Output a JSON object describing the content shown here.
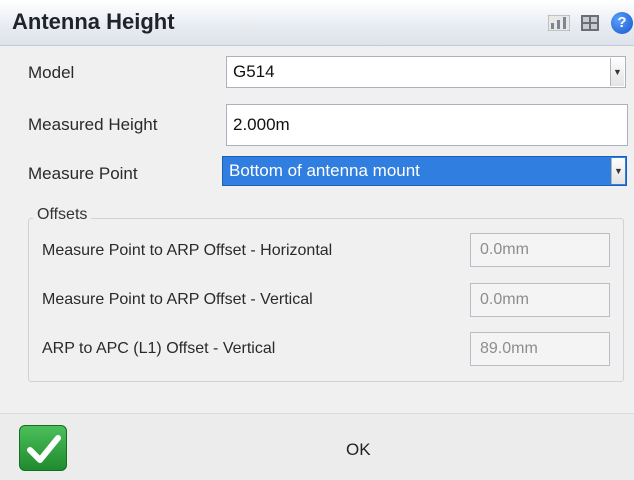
{
  "window": {
    "title": "Antenna Height",
    "icons": [
      "chart-icon",
      "grid-icon",
      "help-icon"
    ]
  },
  "form": {
    "model": {
      "label": "Model",
      "value": "G514"
    },
    "measured_height": {
      "label": "Measured Height",
      "value": "2.000m"
    },
    "measure_point": {
      "label": "Measure Point",
      "value": "Bottom of antenna mount"
    }
  },
  "offsets": {
    "title": "Offsets",
    "rows": [
      {
        "label": "Measure Point to ARP Offset - Horizontal",
        "value": "0.0mm"
      },
      {
        "label": "Measure Point to ARP Offset - Vertical",
        "value": "0.0mm"
      },
      {
        "label": "ARP to APC (L1) Offset - Vertical",
        "value": "89.0mm"
      }
    ]
  },
  "footer": {
    "ok_label": "OK",
    "ok_icon": "checkmark-icon"
  },
  "colors": {
    "selection": "#2f7ee0",
    "ok_green": "#2fa13e",
    "help_blue": "#1656c9"
  }
}
